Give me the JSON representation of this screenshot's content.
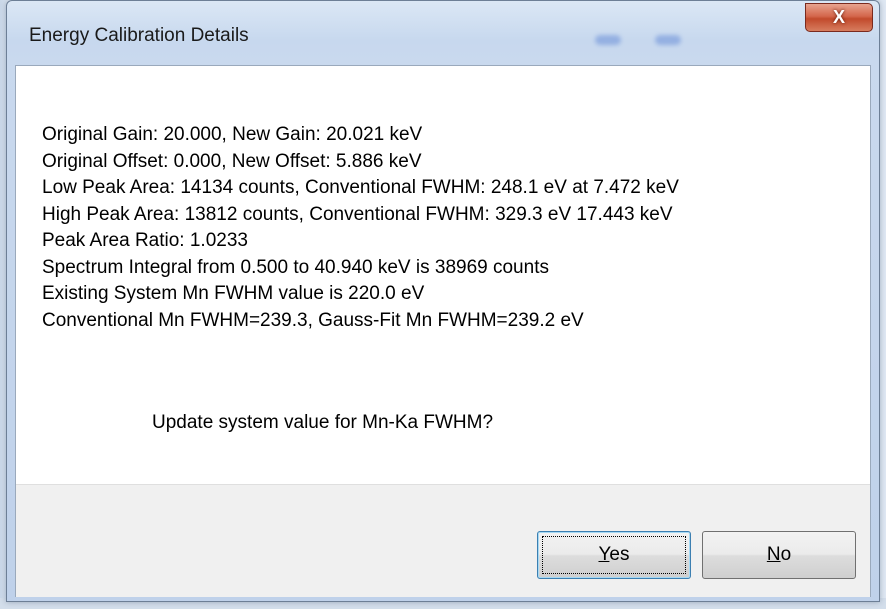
{
  "window": {
    "title": "Energy Calibration Details",
    "close_glyph": "X"
  },
  "message": {
    "lines": [
      "Original Gain: 20.000, New Gain: 20.021 keV",
      "Original Offset: 0.000, New Offset: 5.886 keV",
      "Low Peak Area: 14134 counts, Conventional FWHM: 248.1 eV at 7.472 keV",
      "High Peak Area: 13812 counts, Conventional FWHM: 329.3 eV 17.443 keV",
      "Peak Area Ratio: 1.0233",
      "Spectrum Integral from 0.500 to 40.940 keV is 38969 counts",
      "Existing System Mn FWHM value is 220.0 eV",
      "Conventional Mn FWHM=239.3, Gauss-Fit Mn FWHM=239.2 eV"
    ],
    "prompt": "Update system value for Mn-Ka FWHM?"
  },
  "buttons": {
    "yes_mnemonic": "Y",
    "yes_rest": "es",
    "no_mnemonic": "N",
    "no_rest": "o"
  },
  "colors": {
    "close_button": "#c94a2c",
    "button_bar": "#f0f0f0",
    "title_bar": "#c7d8ee"
  }
}
